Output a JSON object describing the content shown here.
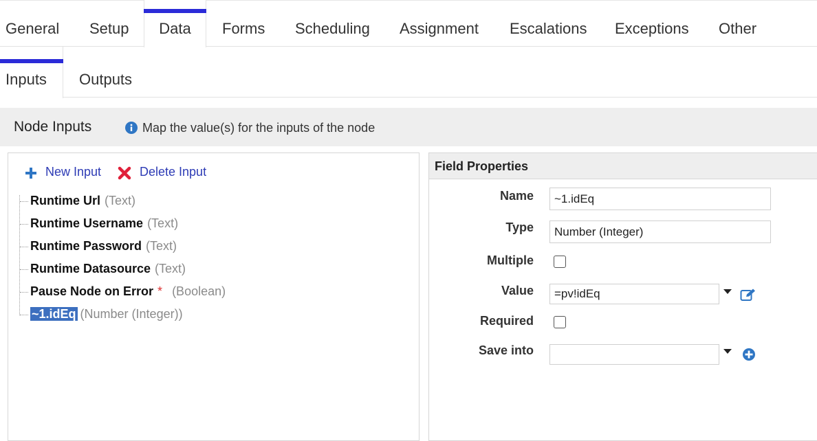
{
  "top_tabs": [
    {
      "label": "General"
    },
    {
      "label": "Setup"
    },
    {
      "label": "Data"
    },
    {
      "label": "Forms"
    },
    {
      "label": "Scheduling"
    },
    {
      "label": "Assignment"
    },
    {
      "label": "Escalations"
    },
    {
      "label": "Exceptions"
    },
    {
      "label": "Other"
    }
  ],
  "active_top_tab": "Data",
  "sub_tabs": [
    {
      "label": "Inputs"
    },
    {
      "label": "Outputs"
    }
  ],
  "active_sub_tab": "Inputs",
  "section": {
    "title": "Node Inputs",
    "hint": "Map the value(s) for the inputs of the node"
  },
  "actions": {
    "new_input": "New Input",
    "delete_input": "Delete Input"
  },
  "inputs": [
    {
      "name": "Runtime Url",
      "type": "(Text)",
      "required": false,
      "selected": false
    },
    {
      "name": "Runtime Username",
      "type": "(Text)",
      "required": false,
      "selected": false
    },
    {
      "name": "Runtime Password",
      "type": "(Text)",
      "required": false,
      "selected": false
    },
    {
      "name": "Runtime Datasource",
      "type": "(Text)",
      "required": false,
      "selected": false
    },
    {
      "name": "Pause Node on Error",
      "type": "(Boolean)",
      "required": true,
      "required_mark": "*",
      "selected": false
    },
    {
      "name": "~1.idEq",
      "type": "(Number (Integer))",
      "required": false,
      "selected": true
    }
  ],
  "field_properties": {
    "title": "Field Properties",
    "name_label": "Name",
    "name_value": "~1.idEq",
    "type_label": "Type",
    "type_value": "Number (Integer)",
    "multiple_label": "Multiple",
    "multiple_checked": false,
    "value_label": "Value",
    "value_value": "=pv!idEq",
    "required_label": "Required",
    "required_checked": false,
    "save_into_label": "Save into",
    "save_into_value": ""
  },
  "colors": {
    "accent": "#2b2bd8",
    "link": "#2d3bb5",
    "selected_bg": "#3c6fbf",
    "delete_red": "#e0203a",
    "icon_blue": "#2f76c4"
  }
}
